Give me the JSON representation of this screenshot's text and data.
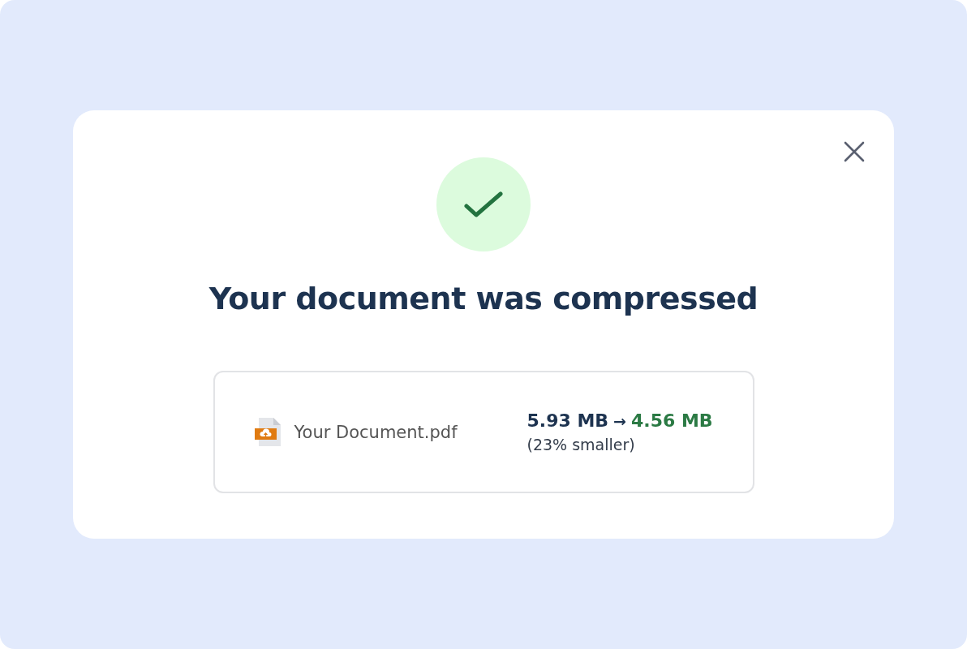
{
  "dialog": {
    "title": "Your document was compressed",
    "file": {
      "name": "Your Document.pdf",
      "original_size": "5.93 MB",
      "arrow": "→",
      "new_size": "4.56 MB",
      "reduction": "(23% smaller)"
    }
  }
}
